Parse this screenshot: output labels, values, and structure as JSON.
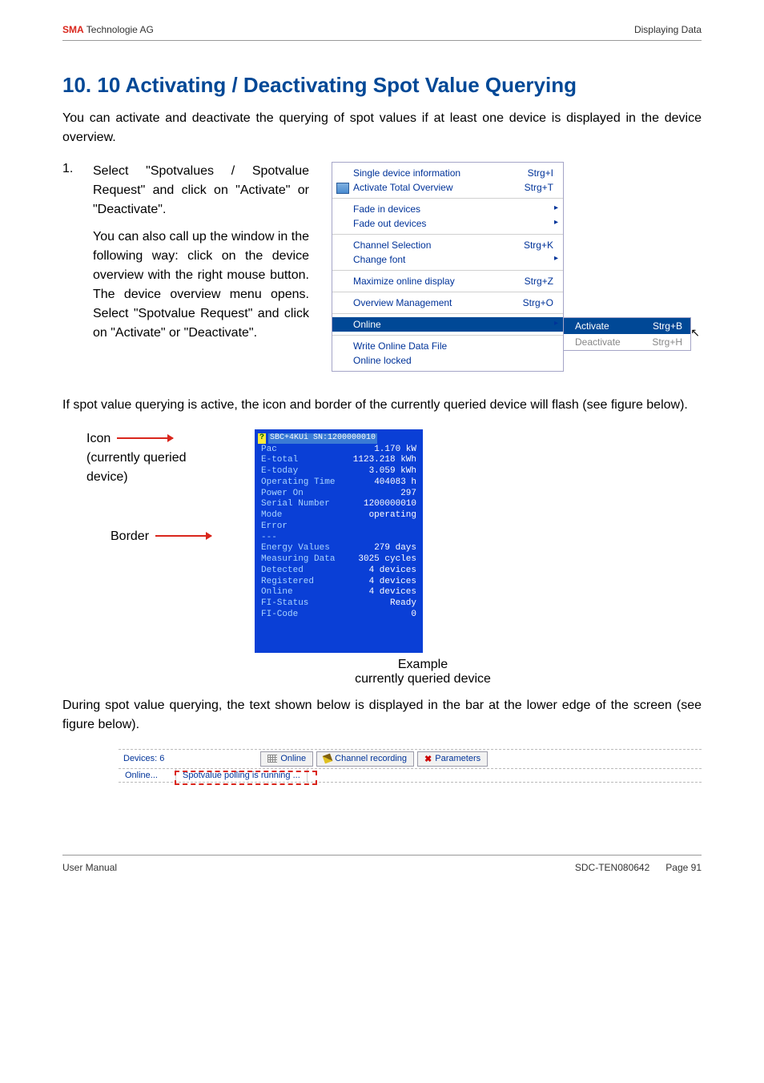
{
  "header": {
    "left_bold": "SMA",
    "left_rest": " Technologie AG",
    "right": "Displaying Data"
  },
  "title": "10. 10 Activating / Deactivating Spot Value Querying",
  "intro": "You can activate and deactivate the querying of spot values if at least one device is displayed in the device overview.",
  "step": {
    "number": "1.",
    "p1": "Select \"Spotvalues / Spotvalue Request\" and click on \"Activate\" or \"Deactivate\".",
    "p2": "You can also call up the window in the following way: click on the device overview with the right mouse button. The device overview menu opens. Select \"Spotvalue Request\" and click on \"Activate\" or \"Deactivate\"."
  },
  "menu": {
    "g1": [
      {
        "label": "Single device information",
        "shortcut": "Strg+I"
      },
      {
        "label": "Activate Total Overview",
        "shortcut": "Strg+T",
        "icon": true
      }
    ],
    "g2": [
      {
        "label": "Fade in devices",
        "arrow": true
      },
      {
        "label": "Fade out devices",
        "arrow": true
      }
    ],
    "g3": [
      {
        "label": "Channel Selection",
        "shortcut": "Strg+K"
      },
      {
        "label": "Change font",
        "arrow": true
      }
    ],
    "g4": [
      {
        "label": "Maximize online display",
        "shortcut": "Strg+Z"
      }
    ],
    "g5": [
      {
        "label": "Overview Management",
        "shortcut": "Strg+O"
      }
    ],
    "g6": [
      {
        "label": "Online",
        "highlighted": true,
        "arrow": true
      }
    ],
    "g7": [
      {
        "label": "Write Online Data File"
      },
      {
        "label": "Online locked"
      }
    ],
    "submenu": [
      {
        "label": "Activate",
        "shortcut": "Strg+B",
        "active": true
      },
      {
        "label": "Deactivate",
        "shortcut": "Strg+H"
      }
    ]
  },
  "mid_para": "If spot value querying is active, the icon and border of the currently queried device will flash (see figure below).",
  "figure_labels": {
    "icon": "Icon",
    "icon_sub": "(currently queried device)",
    "border": "Border"
  },
  "device": {
    "title": "SBC+4KUi SN:1200000010",
    "rows1": [
      {
        "k": "Pac",
        "v": "1.170 kW"
      },
      {
        "k": "E-total",
        "v": "1123.218 kWh"
      },
      {
        "k": "E-today",
        "v": "3.059 kWh"
      },
      {
        "k": "Operating Time",
        "v": "404083 h"
      },
      {
        "k": "Power On",
        "v": "297"
      },
      {
        "k": "Serial Number",
        "v": "1200000010"
      },
      {
        "k": "Mode",
        "v": "operating"
      },
      {
        "k": "Error",
        "v": ""
      }
    ],
    "rows2": [
      {
        "k": "Energy Values",
        "v": "279 days"
      },
      {
        "k": "Measuring Data",
        "v": "3025 cycles"
      },
      {
        "k": "Detected",
        "v": "4 devices"
      },
      {
        "k": "Registered",
        "v": "4 devices"
      },
      {
        "k": "Online",
        "v": "4 devices"
      },
      {
        "k": "FI-Status",
        "v": "Ready"
      },
      {
        "k": "FI-Code",
        "v": "0"
      }
    ]
  },
  "caption": {
    "l1": "Example",
    "l2": "currently queried device"
  },
  "lower_para": "During spot value querying, the text shown below is displayed in the bar at the lower edge of the screen (see figure below).",
  "toolbar": {
    "devices": "Devices:  6",
    "online_btn": "Online",
    "channel_btn": "Channel recording",
    "params_btn": "Parameters"
  },
  "statusbar": {
    "left": "Online...",
    "right": "Spotvalue polling is running ..."
  },
  "footer": {
    "left": "User Manual",
    "mid": "SDC-TEN080642",
    "right": "Page 91"
  }
}
